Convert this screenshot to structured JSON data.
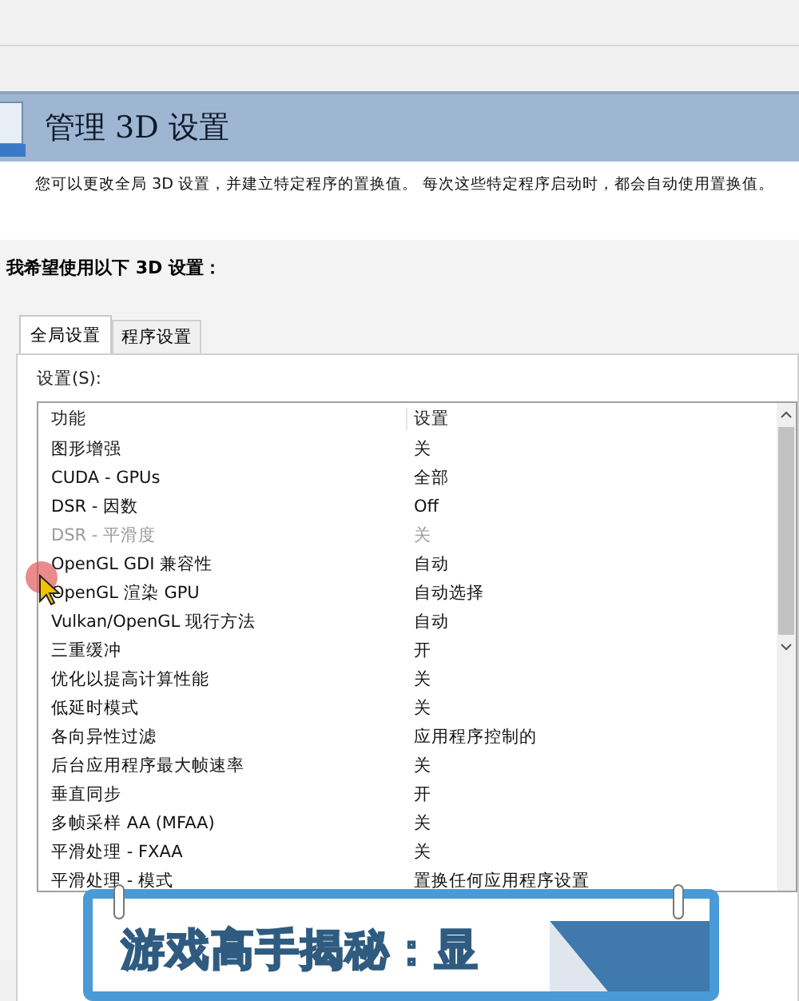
{
  "header": {
    "title": "管理 3D 设置",
    "description": "您可以更改全局 3D 设置，并建立特定程序的置换值。 每次这些特定程序启动时，都会自动使用置换值。"
  },
  "prompt": "我希望使用以下 3D 设置：",
  "tabs": [
    {
      "label": "全局设置",
      "selected": true
    },
    {
      "label": "程序设置",
      "selected": false
    }
  ],
  "settings_label": "设置(S):",
  "table": {
    "columns": [
      "功能",
      "设置"
    ],
    "rows": [
      {
        "feature": "图形增强",
        "setting": "关",
        "disabled": false
      },
      {
        "feature": "CUDA - GPUs",
        "setting": "全部",
        "disabled": false
      },
      {
        "feature": "DSR - 因数",
        "setting": "Off",
        "disabled": false
      },
      {
        "feature": "DSR - 平滑度",
        "setting": "关",
        "disabled": true
      },
      {
        "feature": "OpenGL GDI 兼容性",
        "setting": "自动",
        "disabled": false
      },
      {
        "feature": "OpenGL 渲染 GPU",
        "setting": "自动选择",
        "disabled": false
      },
      {
        "feature": "Vulkan/OpenGL 现行方法",
        "setting": "自动",
        "disabled": false
      },
      {
        "feature": "三重缓冲",
        "setting": "开",
        "disabled": false
      },
      {
        "feature": "优化以提高计算性能",
        "setting": "关",
        "disabled": false
      },
      {
        "feature": "低延时模式",
        "setting": "关",
        "disabled": false
      },
      {
        "feature": "各向异性过滤",
        "setting": "应用程序控制的",
        "disabled": false
      },
      {
        "feature": "后台应用程序最大帧速率",
        "setting": "关",
        "disabled": false
      },
      {
        "feature": "垂直同步",
        "setting": "开",
        "disabled": false
      },
      {
        "feature": "多帧采样 AA (MFAA)",
        "setting": "关",
        "disabled": false
      },
      {
        "feature": "平滑处理 - FXAA",
        "setting": "关",
        "disabled": false
      },
      {
        "feature": "平滑处理 - 模式",
        "setting": "置换任何应用程序设置",
        "disabled": false
      }
    ]
  },
  "banner": {
    "title": "游戏高手揭秘：显"
  }
}
